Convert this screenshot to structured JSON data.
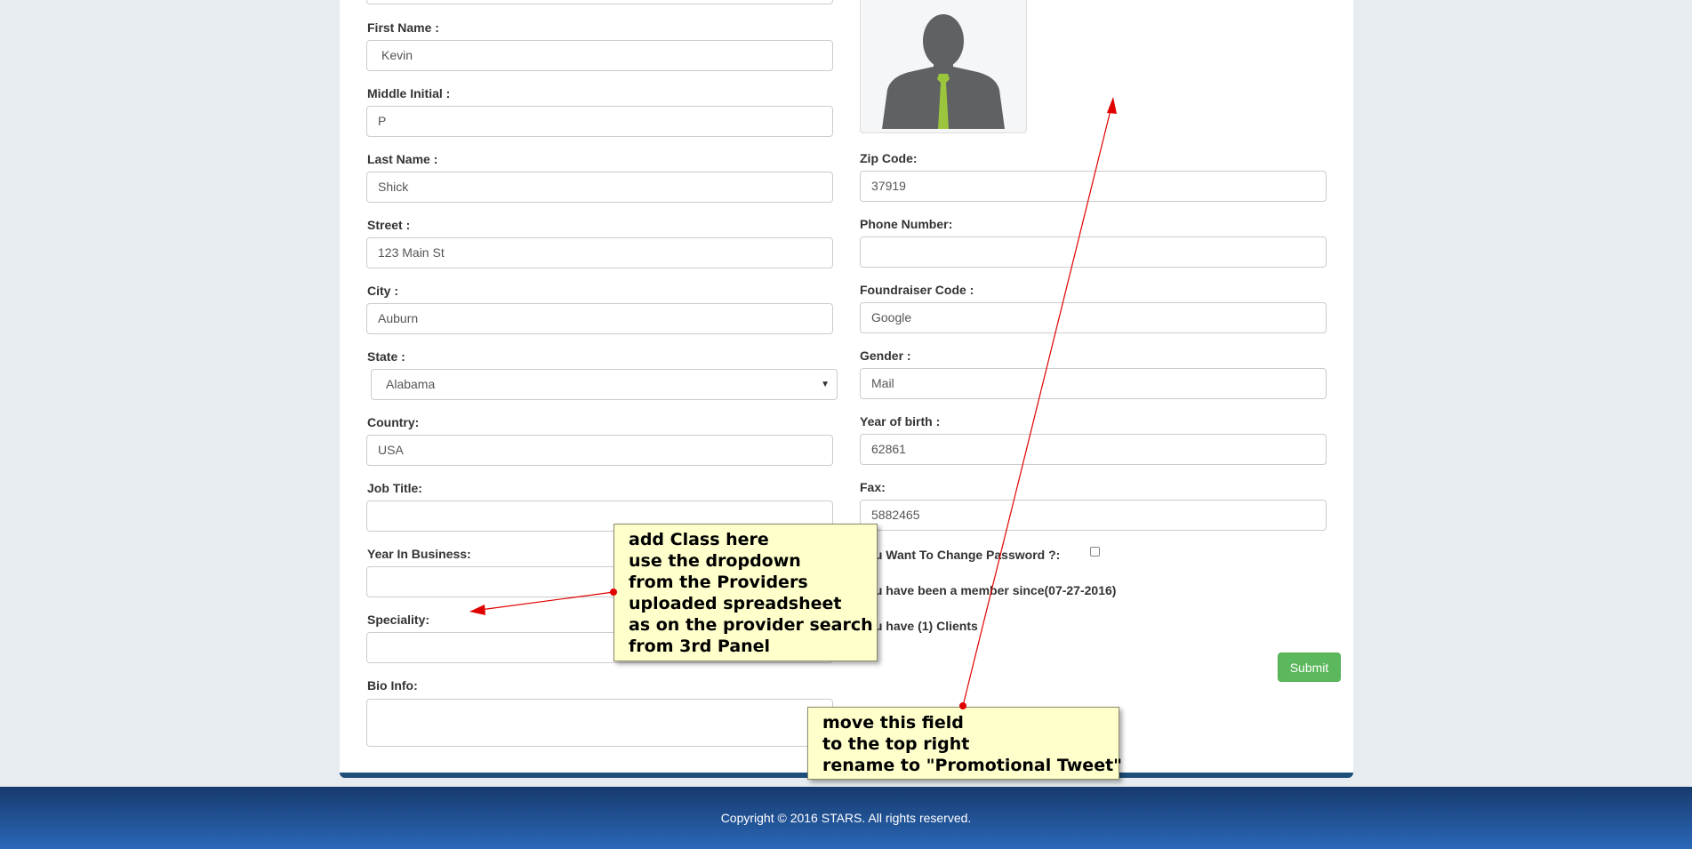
{
  "form": {
    "left": [
      {
        "id": "first_name",
        "label": "First Name :",
        "value": "Kevin"
      },
      {
        "id": "middle_initial",
        "label": "Middle Initial :",
        "value": "P"
      },
      {
        "id": "last_name",
        "label": "Last Name :",
        "value": "Shick"
      },
      {
        "id": "street",
        "label": "Street :",
        "value": "123 Main St"
      },
      {
        "id": "city",
        "label": "City :",
        "value": "Auburn"
      },
      {
        "id": "state",
        "label": "State :",
        "value": "Alabama"
      },
      {
        "id": "country",
        "label": "Country:",
        "value": "USA"
      },
      {
        "id": "job_title",
        "label": "Job Title:",
        "value": ""
      },
      {
        "id": "year_in_business",
        "label": "Year In Business:",
        "value": ""
      },
      {
        "id": "speciality",
        "label": "Speciality:",
        "value": ""
      },
      {
        "id": "bio_info",
        "label": "Bio Info:",
        "value": ""
      }
    ],
    "right": [
      {
        "id": "zip",
        "label": "Zip Code:",
        "value": "37919"
      },
      {
        "id": "phone",
        "label": "Phone Number:",
        "value": ""
      },
      {
        "id": "fundraiser",
        "label": "Foundraiser Code :",
        "value": "Google"
      },
      {
        "id": "gender",
        "label": "Gender :",
        "value": "Mail"
      },
      {
        "id": "year_of_birth",
        "label": "Year of birth :",
        "value": "62861"
      },
      {
        "id": "fax",
        "label": "Fax:",
        "value": "5882465"
      }
    ],
    "change_password_label": "You Want To Change Password ?:",
    "member_since_text": "You have been a member since(07-27-2016)",
    "clients_text": "You have (1) Clients",
    "submit_label": "Submit"
  },
  "annotations": {
    "note1": [
      "add Class here",
      "use the dropdown",
      "from the Providers",
      "uploaded spreadsheet",
      "as on the provider search",
      "from 3rd Panel"
    ],
    "note2": [
      "move this field",
      "to the top right",
      "rename to \"Promotional Tweet\""
    ],
    "note_color": "#ffffcc",
    "arrow_color": "#e00000"
  },
  "footer": {
    "copyright": "Copyright © 2016 STARS. All rights reserved."
  },
  "colors": {
    "background": "#e6ecf0",
    "submit": "#5cb85c",
    "panel_border": "#1f4e7a",
    "footer_top": "#173a6e",
    "footer_bottom": "#2a68b8"
  }
}
